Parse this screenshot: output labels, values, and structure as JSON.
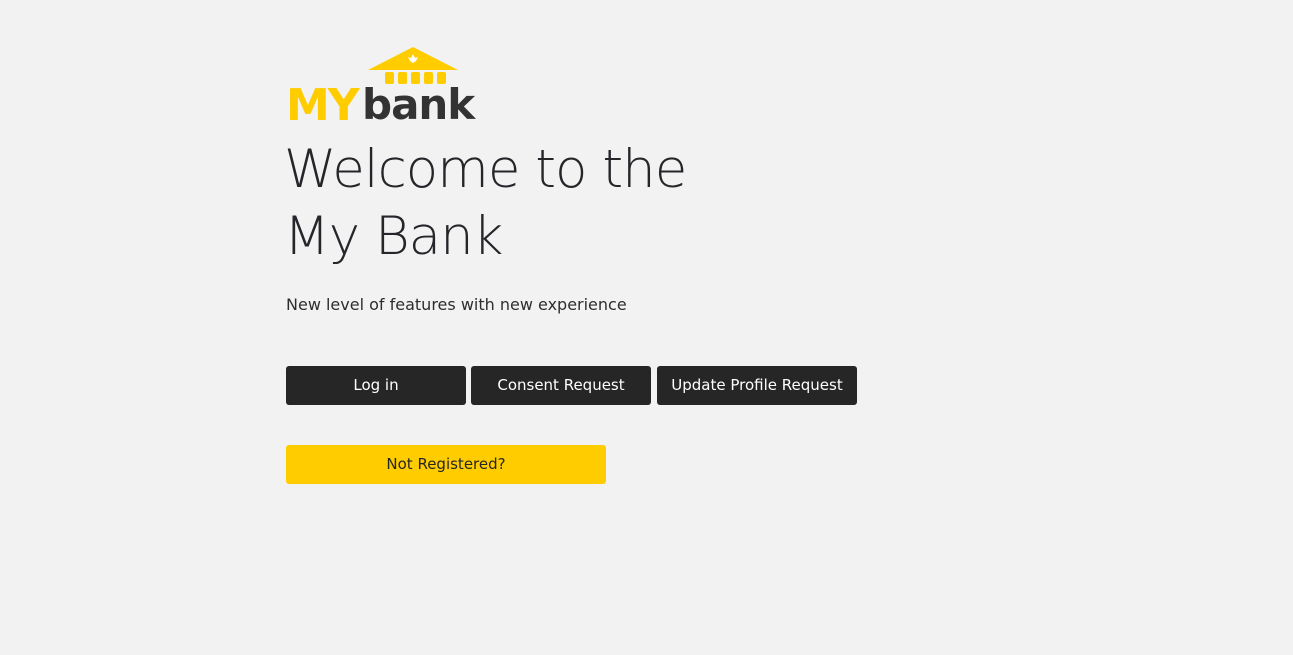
{
  "logo": {
    "text_my": "MY",
    "text_bank": "bank",
    "brand_yellow": "#ffcc00",
    "brand_dark": "#333333"
  },
  "hero": {
    "title_line1": "Welcome to the",
    "title_line2": "My Bank",
    "subtitle": "New level of features with new experience"
  },
  "actions": {
    "login_label": "Log in",
    "consent_label": "Consent Request",
    "update_profile_label": "Update Profile Request",
    "register_label": "Not Registered?"
  },
  "colors": {
    "background": "#f2f2f2",
    "button_dark": "#262626",
    "button_accent": "#ffcc00"
  }
}
